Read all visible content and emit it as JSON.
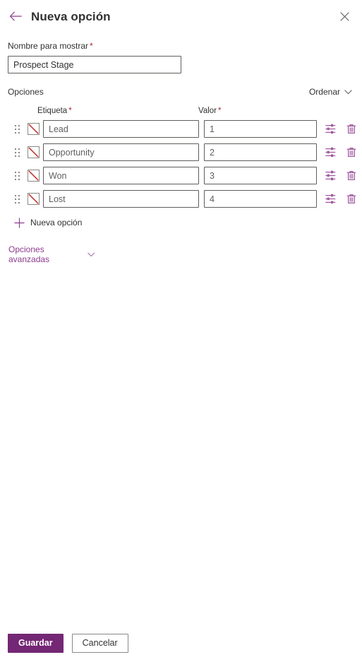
{
  "header": {
    "back_icon": "back-arrow-icon",
    "title": "Nueva opción",
    "close_icon": "close-icon"
  },
  "form": {
    "display_name": {
      "label": "Nombre para mostrar",
      "required_marker": "*",
      "value": "Prospect Stage",
      "placeholder": ""
    }
  },
  "options_section": {
    "title": "Opciones",
    "sort": {
      "label": "Ordenar",
      "icon": "chevron-down-icon"
    },
    "columns": {
      "label": "Etiqueta",
      "label_required": "*",
      "value": "Valor",
      "value_required": "*"
    },
    "rows": [
      {
        "drag_icon": "drag-handle-icon",
        "color_icon": "no-color-swatch-icon",
        "label": "Lead",
        "value": "1",
        "settings_icon": "sliders-icon",
        "delete_icon": "trash-icon"
      },
      {
        "drag_icon": "drag-handle-icon",
        "color_icon": "no-color-swatch-icon",
        "label": "Opportunity",
        "value": "2",
        "settings_icon": "sliders-icon",
        "delete_icon": "trash-icon"
      },
      {
        "drag_icon": "drag-handle-icon",
        "color_icon": "no-color-swatch-icon",
        "label": "Won",
        "value": "3",
        "settings_icon": "sliders-icon",
        "delete_icon": "trash-icon"
      },
      {
        "drag_icon": "drag-handle-icon",
        "color_icon": "no-color-swatch-icon",
        "label": "Lost",
        "value": "4",
        "settings_icon": "sliders-icon",
        "delete_icon": "trash-icon"
      }
    ],
    "add_option": {
      "icon": "plus-icon",
      "label": "Nueva opción"
    }
  },
  "advanced": {
    "label": "Opciones avanzadas",
    "icon": "chevron-down-icon"
  },
  "footer": {
    "save_label": "Guardar",
    "cancel_label": "Cancelar"
  },
  "colors": {
    "accent_purple": "#742774",
    "link_purple": "#8e3a8e",
    "icon_purple": "#a05aa0",
    "required_red": "#a4262c",
    "swatch_slash_red": "#c3332e",
    "text_primary": "#323130",
    "text_secondary": "#605e5c",
    "border_gray": "#605e5c"
  }
}
